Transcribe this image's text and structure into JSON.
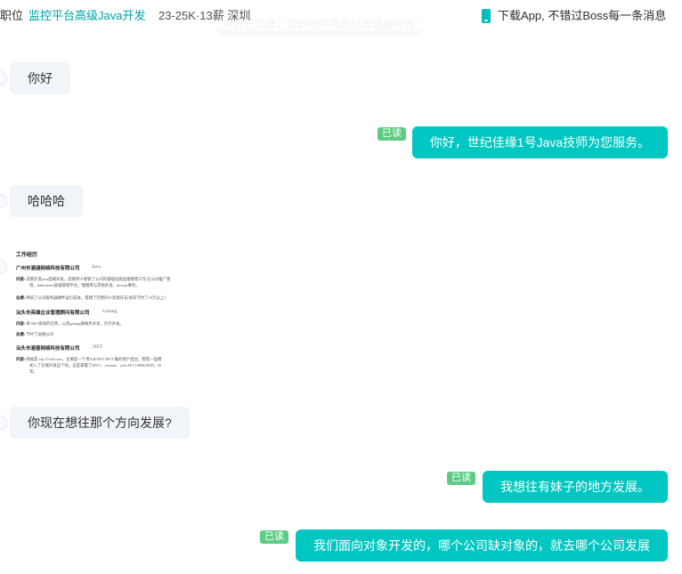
{
  "header": {
    "prefix_label": "职位",
    "job_title": "监控平台高级Java开发",
    "salary_location": "23-25K·13薪 深圳",
    "app_promo": "下载App, 不错过Boss每一条消息"
  },
  "system_notice": "对方已同意，您的附件简历已发送给对方",
  "messages": [
    {
      "side": "left",
      "text": "你好"
    },
    {
      "side": "right",
      "text": "你好，世纪佳缘1号Java技师为您服务。",
      "read": "已读"
    },
    {
      "side": "left",
      "text": "哈哈哈"
    },
    {
      "side": "right",
      "text": "我想往有妹子的地方发展。",
      "read": "已读"
    },
    {
      "side": "right",
      "text": "我们面向对象开发的，哪个公司缺对象的，就去哪个公司发展",
      "read": "已读"
    },
    {
      "side": "left",
      "text": "你现在想往那个方向发展?"
    }
  ],
  "resume": {
    "heading": "工作经历",
    "entries": [
      {
        "company": "广州市涵涵网络科技有限公司",
        "lang": "Java",
        "content_key": "内容:",
        "content": "前期负责java后端开发，后期单人接管了公司的基础设施运维管理工作,在公司推广使",
        "content_cont": "用，kubernetes容器管理平台，慢慢参与其他开发，devops事务。",
        "result_key": "业绩:",
        "result": "降低了公司服务器硬件运行成本，搭建了完善的IT资源开支(每年节约了10万以上)"
      },
      {
        "company": "汕头市英雄企业管理顾问有限公司",
        "lang": "Golang",
        "content_key": "内容:",
        "content": "将.NET系统的迁移，以及golang做服务开发，另外开发。",
        "result_key": "业绩:",
        "result": "节约了运维公司"
      },
      {
        "company": "汕头市涵普网络科技有限公司",
        "lang": ".NET",
        "content_key": "内容:",
        "content": "网站是 vip.17eod.com，主要是一个用ASP.NET MVC做的用户后台。管理一些模",
        "content_cont": "式入了在端开发这个坑。这是掌握了MVC、session、web API ,ORM,DDD，IE",
        "content_cont2": "等。"
      }
    ]
  },
  "colors": {
    "accent": "#00a6a7",
    "sent_bubble": "#00c7c1",
    "received_bubble": "#f1f4f9",
    "read_badge": "#5dcc83"
  }
}
